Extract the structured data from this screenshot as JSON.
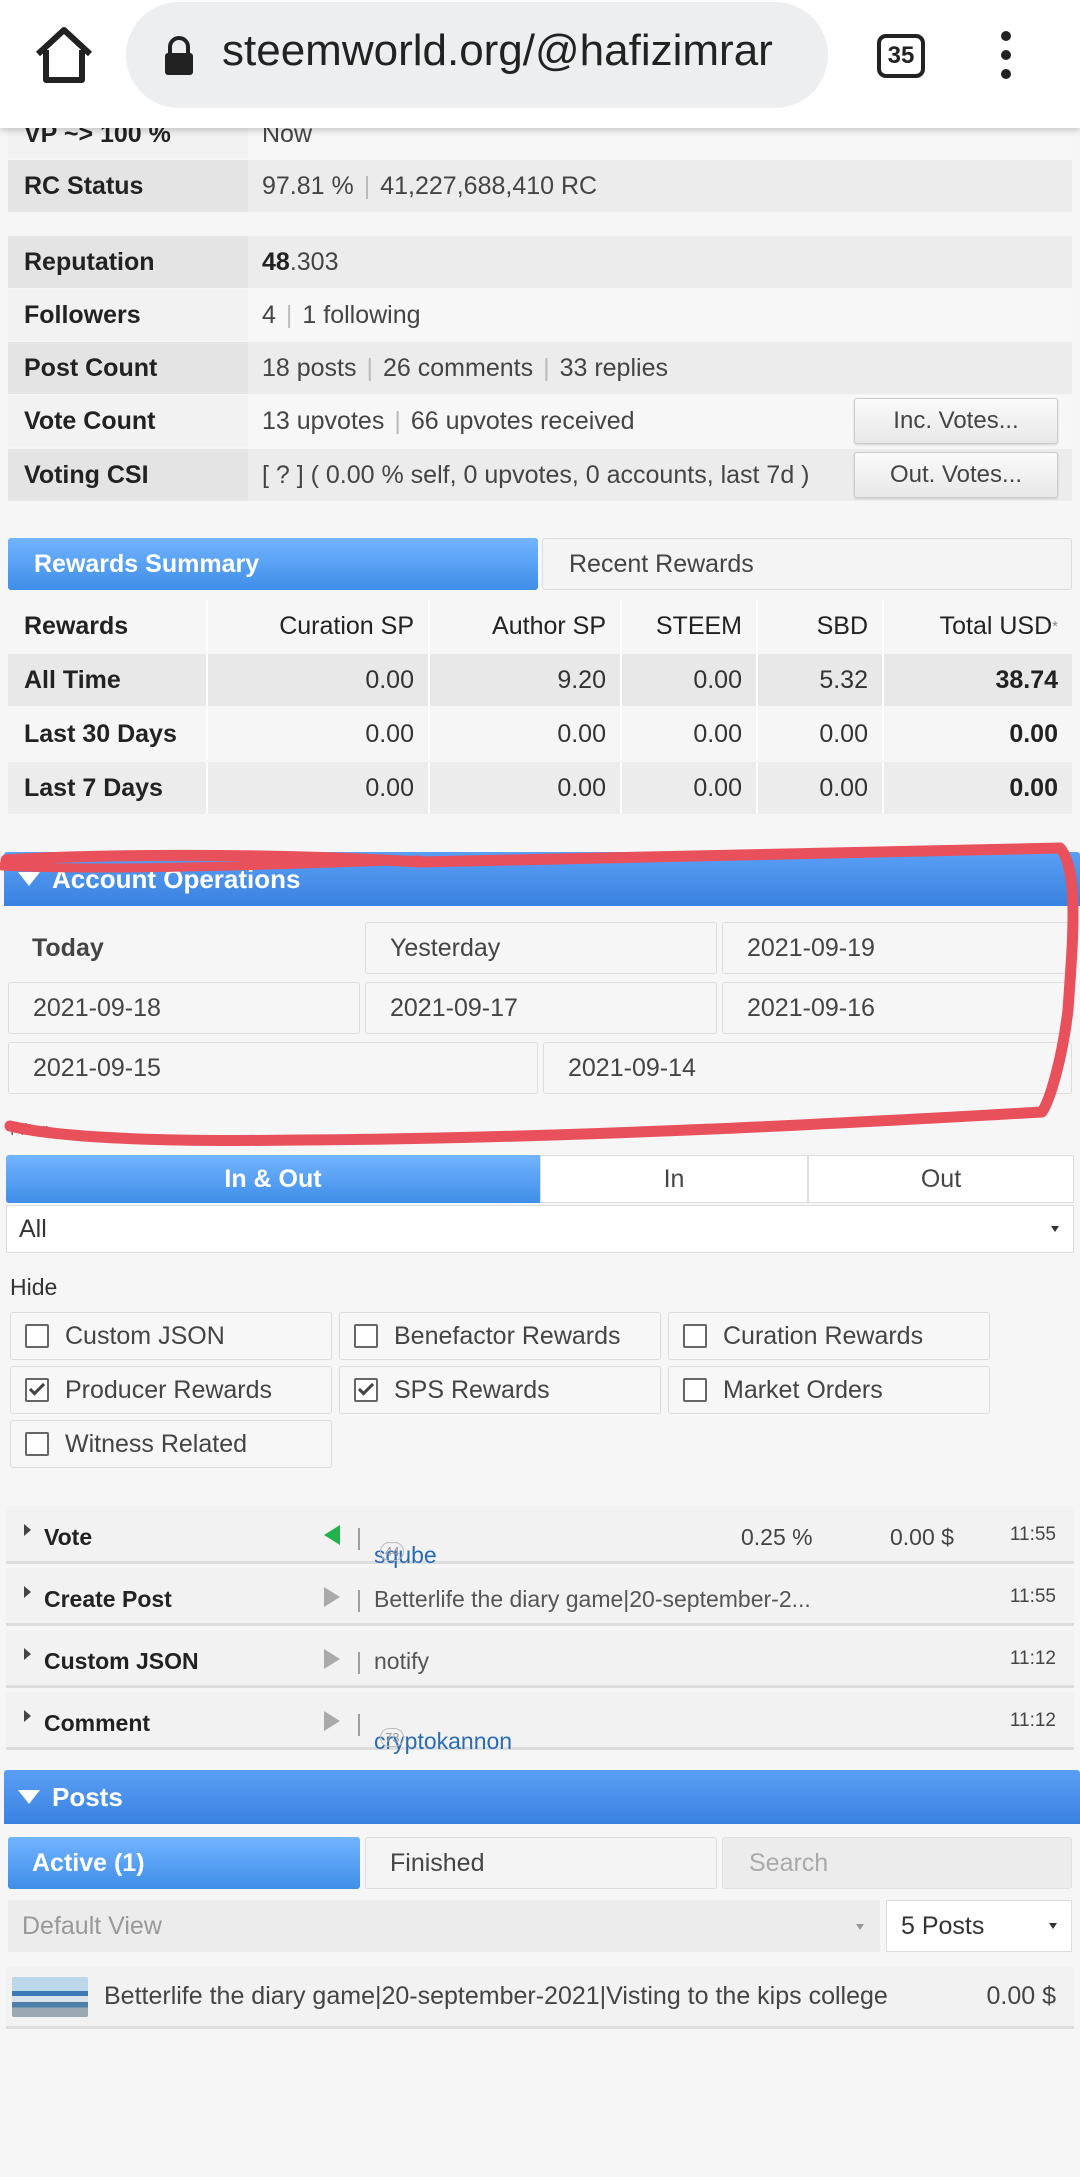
{
  "browser": {
    "url": "steemworld.org/@hafizimrar",
    "tab_count": "35",
    "icons": [
      "home-icon",
      "lock-icon",
      "more-vert-icon"
    ]
  },
  "stats": {
    "vp_label": "VP ~> 100 %",
    "vp_value": "Now",
    "rc_label": "RC Status",
    "rc_pct": "97.81 %",
    "rc_amount": "41,227,688,410 RC",
    "reputation_label": "Reputation",
    "reputation_int": "48",
    "reputation_dec": ".303",
    "followers_label": "Followers",
    "followers": "4",
    "following": "1 following",
    "postcount_label": "Post Count",
    "posts": "18 posts",
    "comments": "26 comments",
    "replies": "33 replies",
    "votecount_label": "Vote Count",
    "upvotes": "13 upvotes",
    "upvotes_received": "66 upvotes received",
    "inc_votes_btn": "Inc. Votes...",
    "csi_label": "Voting CSI",
    "csi_value": "[ ? ] ( 0.00 % self, 0 upvotes, 0 accounts, last 7d )",
    "out_votes_btn": "Out. Votes..."
  },
  "rewards": {
    "tab_summary": "Rewards Summary",
    "tab_recent": "Recent Rewards",
    "headers": [
      "Rewards",
      "Curation SP",
      "Author SP",
      "STEEM",
      "SBD",
      "Total USD"
    ],
    "usd_asterisk": "*",
    "rows": [
      [
        "All Time",
        "0.00",
        "9.20",
        "0.00",
        "5.32",
        "38.74"
      ],
      [
        "Last 30 Days",
        "0.00",
        "0.00",
        "0.00",
        "0.00",
        "0.00"
      ],
      [
        "Last 7 Days",
        "0.00",
        "0.00",
        "0.00",
        "0.00",
        "0.00"
      ]
    ]
  },
  "account_ops": {
    "header": "Account Operations",
    "dates": [
      "Today",
      "Yesterday",
      "2021-09-19",
      "2021-09-18",
      "2021-09-17",
      "2021-09-16",
      "2021-09-15",
      "2021-09-14"
    ],
    "filter_label": "Filter",
    "filter_tabs": [
      "In & Out",
      "In",
      "Out"
    ],
    "type_select": "All",
    "hide_label": "Hide",
    "hide_options": [
      {
        "label": "Custom JSON",
        "checked": false
      },
      {
        "label": "Benefactor Rewards",
        "checked": false
      },
      {
        "label": "Curation Rewards",
        "checked": false
      },
      {
        "label": "Producer Rewards",
        "checked": true
      },
      {
        "label": "SPS Rewards",
        "checked": true
      },
      {
        "label": "Market Orders",
        "checked": false
      },
      {
        "label": "Witness Related",
        "checked": false
      }
    ],
    "operations": [
      {
        "type": "Vote",
        "target": "sqube",
        "rep": "44",
        "pct": "0.25 %",
        "usd": "0.00 $",
        "time": "11:55",
        "dir_color": "#22b14c"
      },
      {
        "type": "Create Post",
        "target": "Betterlife the diary game|20-september-2...",
        "time": "11:55",
        "dir_color": "#aaaaaa"
      },
      {
        "type": "Custom JSON",
        "target": "notify",
        "time": "11:12",
        "dir_color": "#aaaaaa"
      },
      {
        "type": "Comment",
        "target": "cryptokannon",
        "rep": "73",
        "time": "11:12",
        "dir_color": "#aaaaaa"
      }
    ],
    "annotation_color": "#e8505b"
  },
  "posts": {
    "header": "Posts",
    "tab_active": "Active (1)",
    "tab_finished": "Finished",
    "search_placeholder": "Search",
    "view_select": "Default View",
    "count_select": "5 Posts",
    "items": [
      {
        "title": "Betterlife the diary game|20-september-2021|Visting to the kips college",
        "value": "0.00 $"
      }
    ]
  },
  "colors": {
    "accent": "#4a92ee",
    "annotation": "#e8505b"
  }
}
